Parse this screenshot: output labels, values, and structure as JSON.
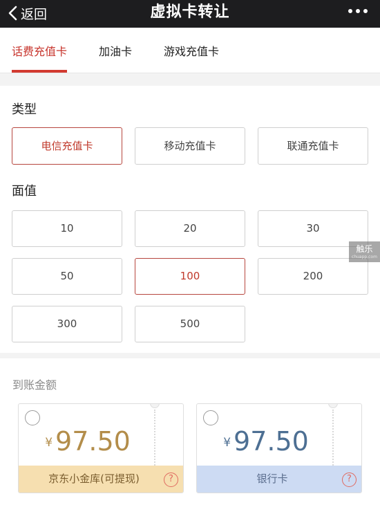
{
  "navbar": {
    "back_label": "返回",
    "title": "虚拟卡转让",
    "more_icon": "more-dots-icon"
  },
  "tabs": [
    {
      "label": "话费充值卡",
      "active": true
    },
    {
      "label": "加油卡",
      "active": false
    },
    {
      "label": "游戏充值卡",
      "active": false
    }
  ],
  "type_section": {
    "label": "类型",
    "options": [
      {
        "label": "电信充值卡",
        "selected": true
      },
      {
        "label": "移动充值卡",
        "selected": false
      },
      {
        "label": "联通充值卡",
        "selected": false
      }
    ]
  },
  "value_section": {
    "label": "面值",
    "options": [
      {
        "label": "10",
        "selected": false
      },
      {
        "label": "20",
        "selected": false
      },
      {
        "label": "30",
        "selected": false
      },
      {
        "label": "50",
        "selected": false
      },
      {
        "label": "100",
        "selected": true
      },
      {
        "label": "200",
        "selected": false
      },
      {
        "label": "300",
        "selected": false
      },
      {
        "label": "500",
        "selected": false
      }
    ]
  },
  "receive": {
    "label": "到账金额",
    "cards": [
      {
        "currency": "¥",
        "amount": "97.50",
        "destination": "京东小金库(可提现)",
        "help": "?"
      },
      {
        "currency": "¥",
        "amount": "97.50",
        "destination": "银行卡",
        "help": "?"
      }
    ]
  },
  "watermark": {
    "main": "触乐",
    "sub": "chuapp.com"
  },
  "colors": {
    "accent": "#c7342c",
    "navbar": "#1d1d1f",
    "jd_footer": "#f6dfb0",
    "bank_footer": "#cddbf3",
    "jd_amount": "#b38d4a",
    "bank_amount": "#4d6f93"
  }
}
